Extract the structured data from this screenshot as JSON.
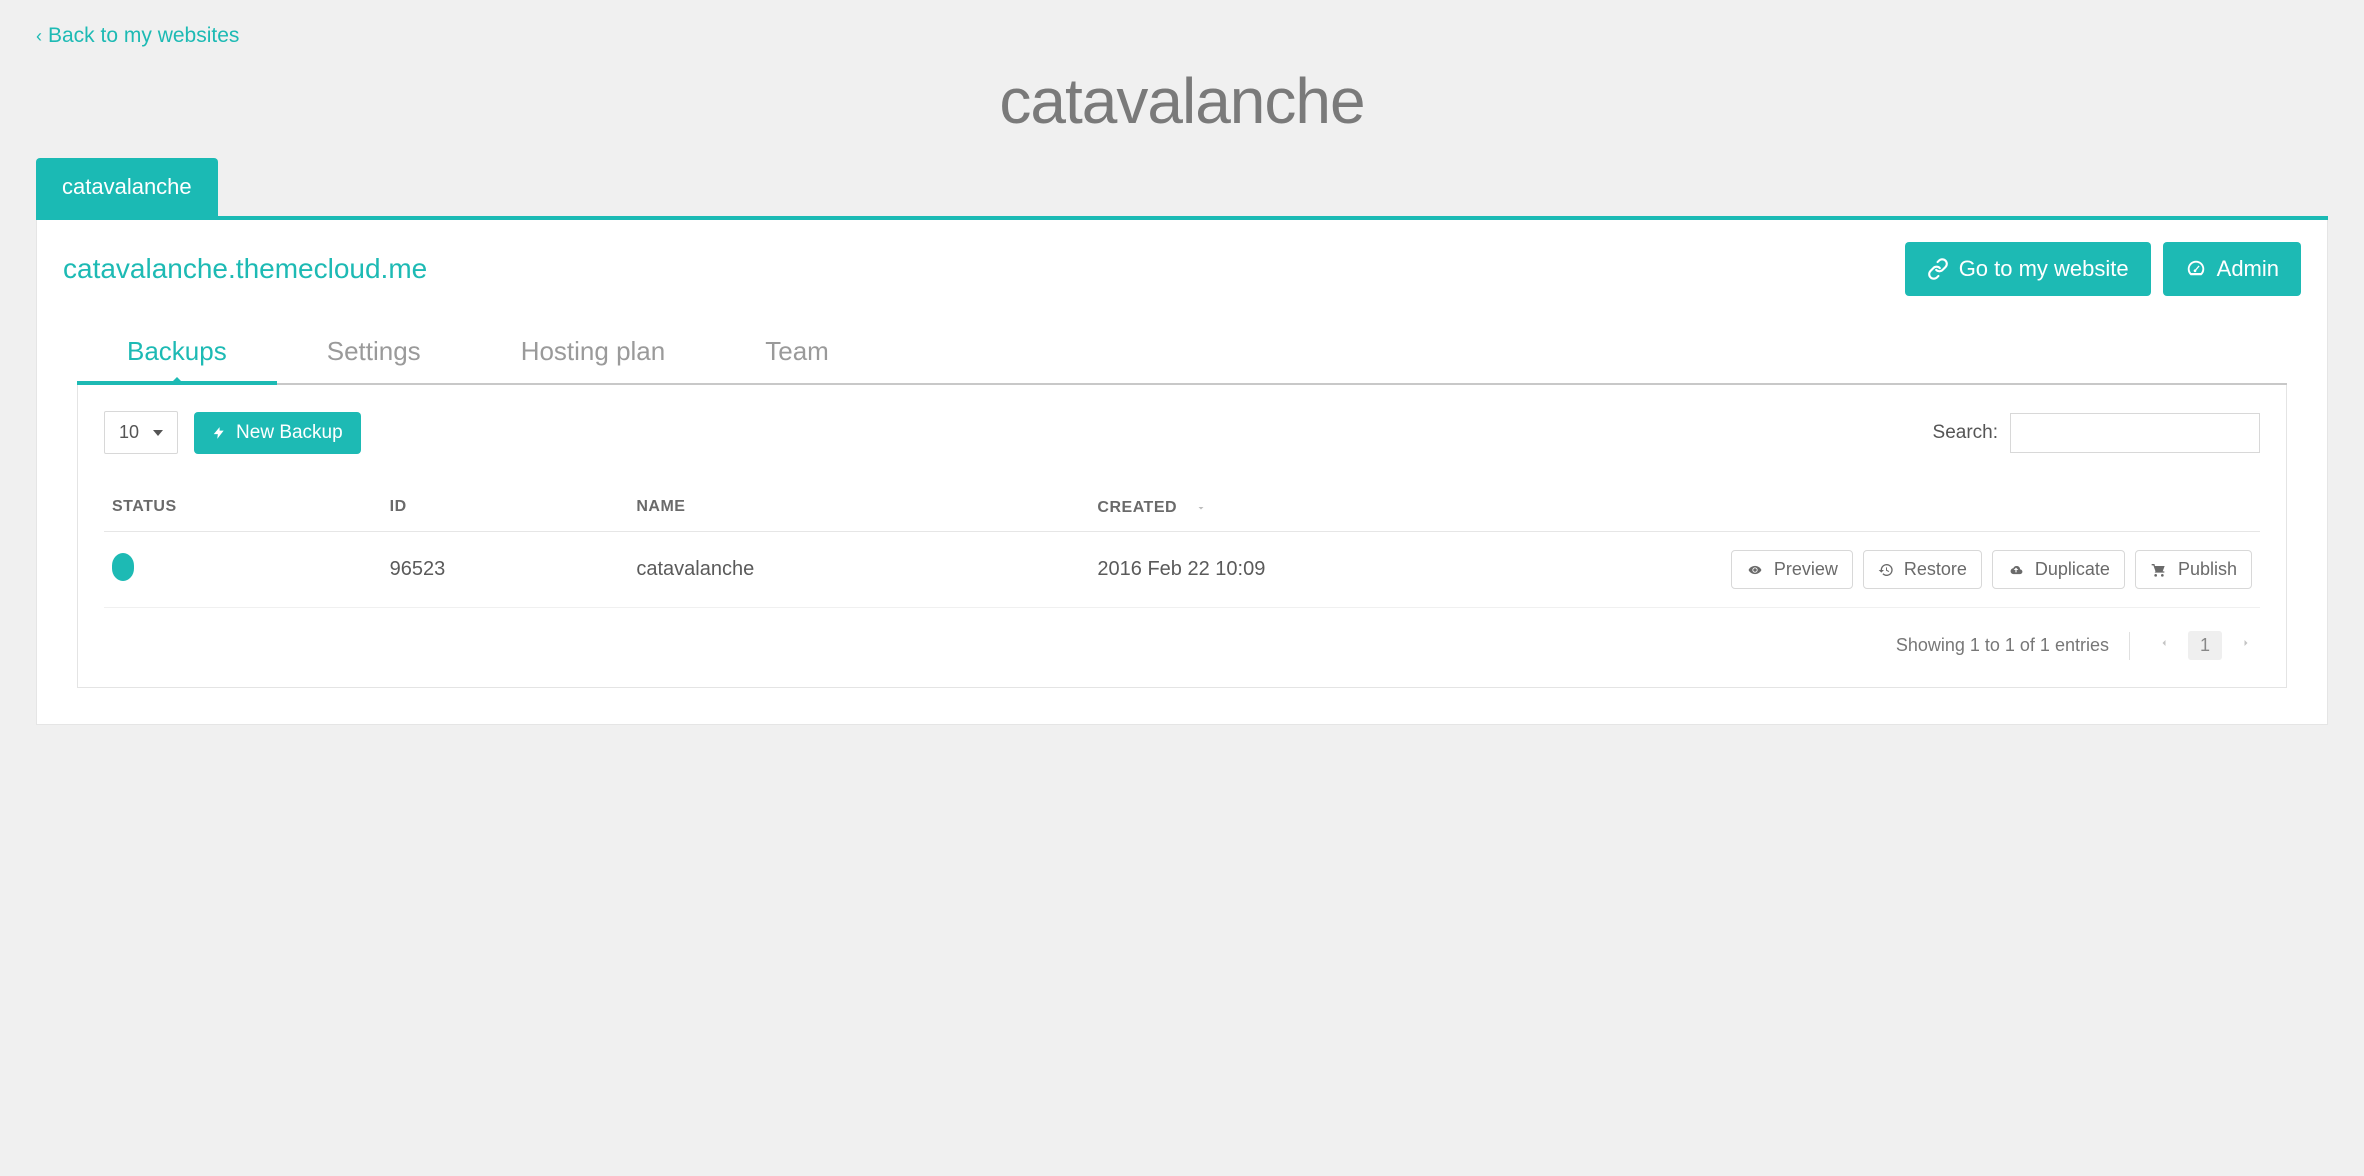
{
  "nav": {
    "back_label": "Back to my websites"
  },
  "page": {
    "title": "catavalanche"
  },
  "site_tabs": [
    {
      "label": "catavalanche",
      "active": true
    }
  ],
  "header": {
    "site_url": "catavalanche.themecloud.me",
    "go_to_website_label": "Go to my website",
    "admin_label": "Admin"
  },
  "subnav": {
    "tabs": [
      {
        "label": "Backups",
        "active": true
      },
      {
        "label": "Settings",
        "active": false
      },
      {
        "label": "Hosting plan",
        "active": false
      },
      {
        "label": "Team",
        "active": false
      }
    ]
  },
  "toolbar": {
    "page_size": "10",
    "new_backup_label": "New Backup",
    "search_label": "Search:",
    "search_value": ""
  },
  "table": {
    "columns": {
      "status": "STATUS",
      "id": "ID",
      "name": "NAME",
      "created": "CREATED"
    },
    "rows": [
      {
        "status_color": "#1dbab4",
        "id": "96523",
        "name": "catavalanche",
        "created": "2016 Feb 22 10:09",
        "actions": {
          "preview": "Preview",
          "restore": "Restore",
          "duplicate": "Duplicate",
          "publish": "Publish"
        }
      }
    ]
  },
  "footer": {
    "showing_prefix": "Showing ",
    "range": "1 to 1",
    "showing_mid": " of 1 entries",
    "current_page": "1"
  }
}
